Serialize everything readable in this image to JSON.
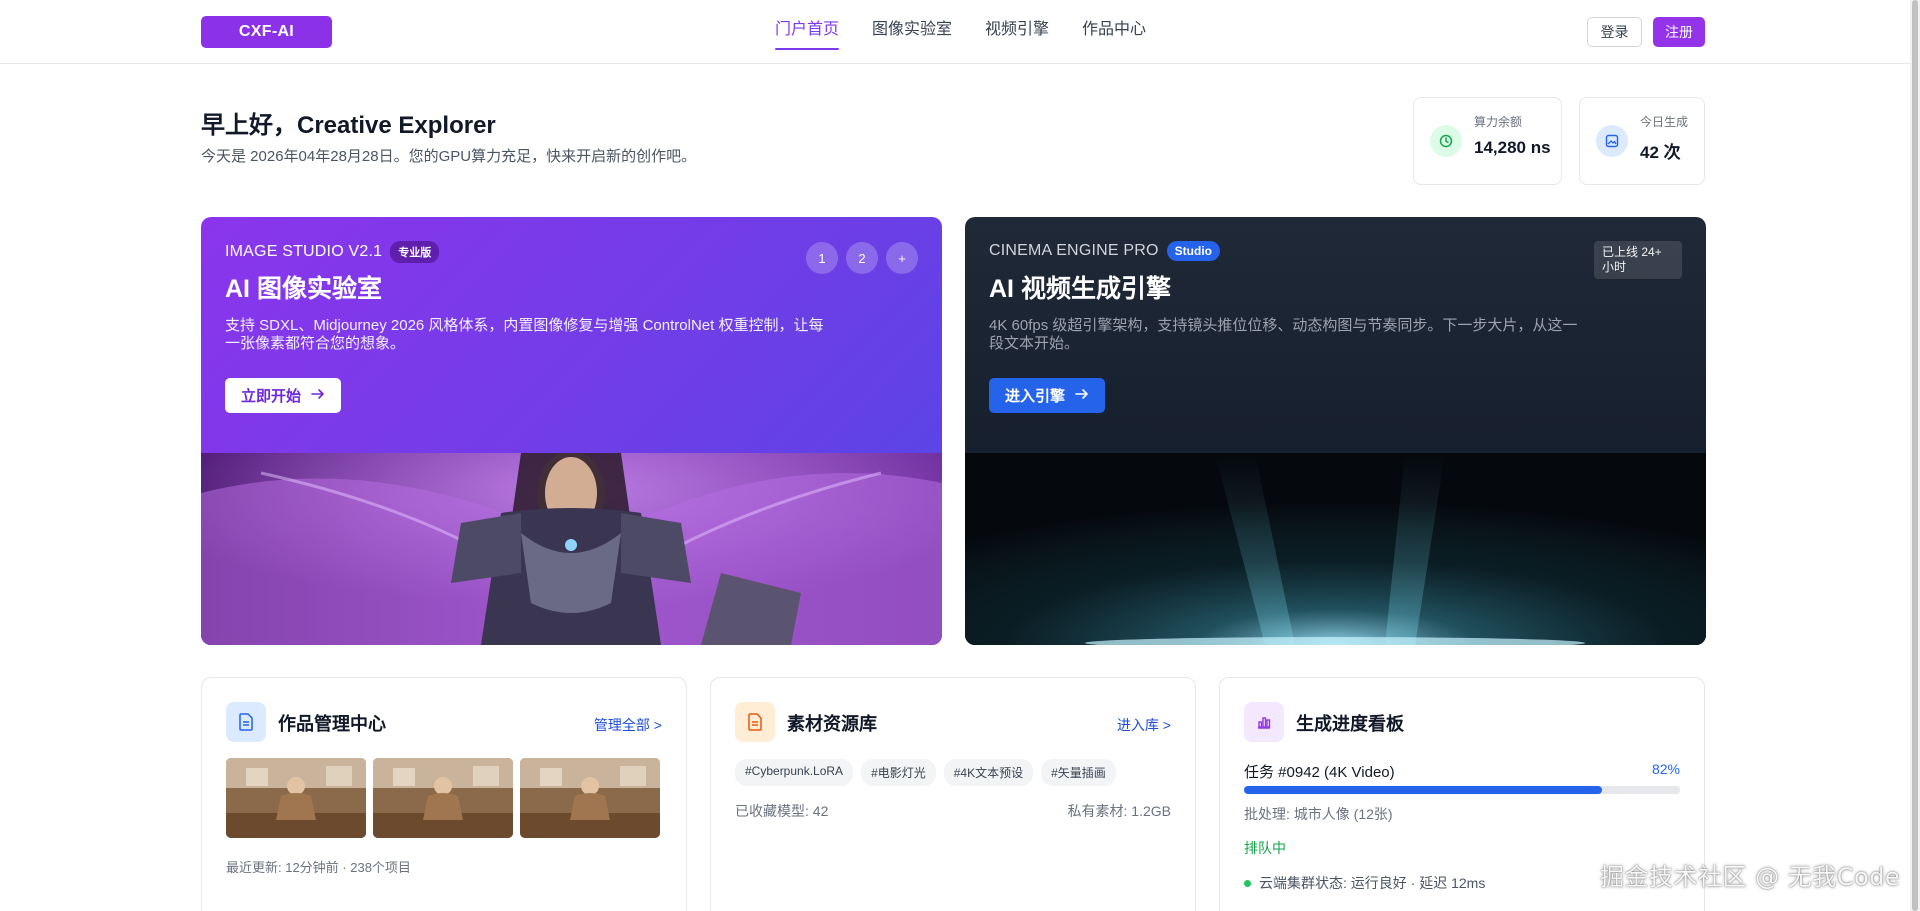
{
  "header": {
    "logo": "CXF-AI",
    "nav": [
      "门户首页",
      "图像实验室",
      "视频引擎",
      "作品中心"
    ],
    "login": "登录",
    "register": "注册"
  },
  "greeting": {
    "title": "早上好，Creative Explorer",
    "subtitle": "今天是 2026年04年28月28日。您的GPU算力充足，快来开启新的创作吧。"
  },
  "stats": [
    {
      "label": "算力余额",
      "value": "14,280 ns",
      "icon": "clock-icon",
      "accent": "#22c55e"
    },
    {
      "label": "今日生成",
      "value": "42 次",
      "icon": "image-icon",
      "accent": "#3b82f6"
    }
  ],
  "hero_image": {
    "eyebrow": "IMAGE STUDIO V2.1",
    "badge": "专业版",
    "title": "AI 图像实验室",
    "description": "支持 SDXL、Midjourney 2026 风格体系，内置图像修复与增强 ControlNet 权重控制，让每一张像素都符合您的想象。",
    "cta": "立即开始",
    "pager": [
      "1",
      "2",
      "+"
    ]
  },
  "hero_video": {
    "eyebrow": "CINEMA ENGINE PRO",
    "badge": "Studio",
    "online": "已上线 24+ 小时",
    "title": "AI 视频生成引擎",
    "description": "4K 60fps 级超引擎架构，支持镜头推位位移、动态构图与节奏同步。下一步大片，从这一段文本开始。",
    "cta": "进入引擎"
  },
  "works": {
    "title": "作品管理中心",
    "link": "管理全部 >",
    "meta": "最近更新: 12分钟前 · 238个项目"
  },
  "library": {
    "title": "素材资源库",
    "link": "进入库 >",
    "tags": [
      "#Cyberpunk.LoRA",
      "#电影灯光",
      "#4K文本预设",
      "#矢量插画"
    ],
    "models": "已收藏模型: 42",
    "assets": "私有素材: 1.2GB"
  },
  "progress": {
    "title": "生成进度看板",
    "task": "任务 #0942 (4K Video)",
    "percent_label": "82%",
    "percent": 0.82,
    "batch": "批处理: 城市人像 (12张)",
    "status": "排队中",
    "cluster": "云端集群状态: 运行良好 · 延迟 12ms"
  },
  "watermark": "掘金技术社区 @ 无我Code",
  "colors": {
    "brand": "#8b32e8",
    "primary_blue": "#2563eb",
    "success": "#16a34a"
  }
}
